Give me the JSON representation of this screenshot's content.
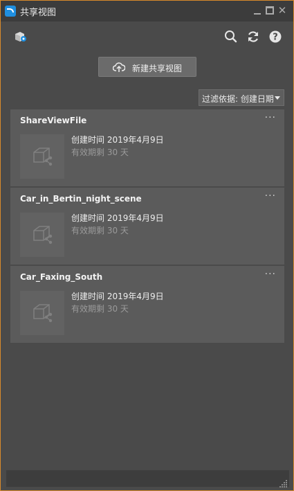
{
  "window": {
    "title": "共享视图"
  },
  "toolbar": {
    "icons": [
      "share-view-logo-icon",
      "search-icon",
      "refresh-icon",
      "help-icon"
    ]
  },
  "new_button": {
    "label": "新建共享视图",
    "icon": "cloud-upload-icon"
  },
  "filter": {
    "label": "过滤依据: 创建日期"
  },
  "cards": [
    {
      "name": "ShareViewFile",
      "created": "创建时间 2019年4月9日",
      "expires": "有效期剩 30 天"
    },
    {
      "name": "Car_in_Bertin_night_scene",
      "created": "创建时间 2019年4月9日",
      "expires": "有效期剩 30 天"
    },
    {
      "name": "Car_Faxing_South",
      "created": "创建时间 2019年4月9日",
      "expires": "有效期剩 30 天"
    }
  ],
  "colors": {
    "accent_border": "#d98a2b",
    "app_icon": "#1f8fe0"
  }
}
